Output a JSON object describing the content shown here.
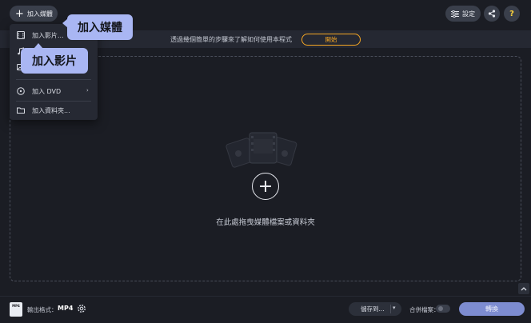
{
  "toolbar": {
    "add_media_label": "加入媒體",
    "settings_label": "設定",
    "help_label": "?"
  },
  "info_bar": {
    "message": "透過幾個簡單的步驟來了解如何使用本程式",
    "start_label": "開始"
  },
  "dropzone": {
    "text": "在此處拖曳媒體檔案或資料夾"
  },
  "add_menu": {
    "items": [
      {
        "label": "加入影片...",
        "icon": "film-icon"
      },
      {
        "label": "",
        "icon": "music-icon"
      },
      {
        "label": "",
        "icon": "image-icon"
      },
      {
        "label": "加入 DVD",
        "icon": "dvd-icon",
        "has_submenu": true
      },
      {
        "label": "加入資料夾...",
        "icon": "folder-icon"
      }
    ]
  },
  "tooltips": {
    "add_media": "加入媒體",
    "add_video": "加入影片"
  },
  "bottom_bar": {
    "format_icon_text": "MP4",
    "output_format_label": "輸出格式：",
    "output_format_value": "MP4",
    "save_to_label": "儲存到...",
    "merge_label": "合併檔案：",
    "merge_enabled": false,
    "convert_label": "轉換"
  },
  "colors": {
    "background": "#1b1d24",
    "accent_orange": "#f5a623",
    "tooltip_bg": "#a9b6f3",
    "convert_button": "#7d8cd0",
    "help_yellow": "#ffd43b"
  }
}
